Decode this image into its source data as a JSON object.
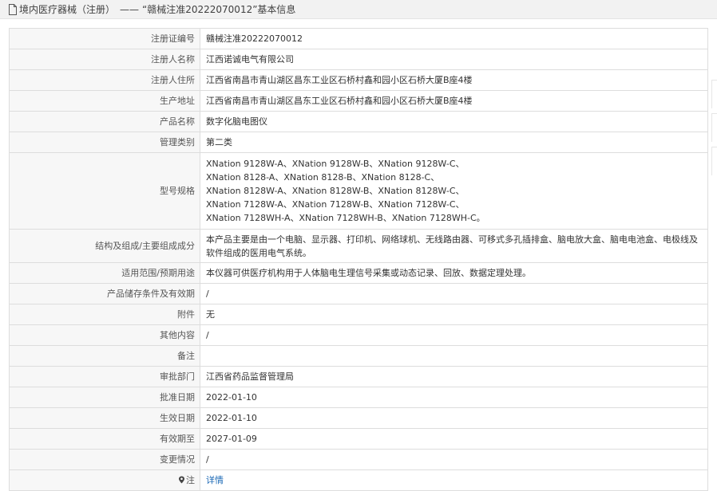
{
  "header": {
    "category": "境内医疗器械（注册）",
    "separator": "——",
    "title": "“赣械注准20222070012”基本信息"
  },
  "rows": [
    {
      "label": "注册证编号",
      "value": "赣械注准20222070012"
    },
    {
      "label": "注册人名称",
      "value": "江西诺诚电气有限公司"
    },
    {
      "label": "注册人住所",
      "value": "江西省南昌市青山湖区昌东工业区石桥村鑫和园小区石桥大厦B座4楼"
    },
    {
      "label": "生产地址",
      "value": "江西省南昌市青山湖区昌东工业区石桥村鑫和园小区石桥大厦B座4楼"
    },
    {
      "label": "产品名称",
      "value": "数字化脑电图仪"
    },
    {
      "label": "管理类别",
      "value": "第二类"
    },
    {
      "label": "型号规格",
      "value": "XNation 9128W-A、XNation 9128W-B、XNation 9128W-C、\nXNation 8128-A、XNation 8128-B、XNation 8128-C、\nXNation 8128W-A、XNation 8128W-B、XNation 8128W-C、\nXNation 7128W-A、XNation 7128W-B、XNation 7128W-C、\nXNation 7128WH-A、XNation 7128WH-B、XNation 7128WH-C。"
    },
    {
      "label": "结构及组成/主要组成成分",
      "value": "本产品主要是由一个电脑、显示器、打印机、网络球机、无线路由器、可移式多孔插排盒、脑电放大盒、脑电电池盒、电极线及软件组成的医用电气系统。"
    },
    {
      "label": "适用范围/预期用途",
      "value": "本仪器可供医疗机构用于人体脑电生理信号采集或动态记录、回放、数据定理处理。"
    },
    {
      "label": "产品储存条件及有效期",
      "value": "/"
    },
    {
      "label": "附件",
      "value": "无"
    },
    {
      "label": "其他内容",
      "value": "/"
    },
    {
      "label": "备注",
      "value": ""
    },
    {
      "label": "审批部门",
      "value": "江西省药品监督管理局"
    },
    {
      "label": "批准日期",
      "value": "2022-01-10"
    },
    {
      "label": "生效日期",
      "value": "2022-01-10"
    },
    {
      "label": "有效期至",
      "value": "2027-01-09"
    },
    {
      "label": "变更情况",
      "value": "/"
    }
  ],
  "note": {
    "label": "注",
    "link": "详情"
  },
  "colors": {
    "label_bg": "#f7f7f7",
    "border": "#dddddd",
    "link": "#1a68b5",
    "header_bg": "#f2f2f2"
  },
  "icons": [
    "document-icon",
    "location-pin-icon"
  ]
}
